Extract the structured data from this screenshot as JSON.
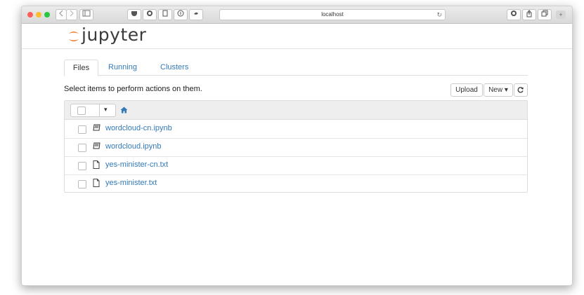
{
  "browser": {
    "address": "localhost"
  },
  "app": {
    "logo_text": "jupyter"
  },
  "tabs": [
    {
      "label": "Files",
      "active": true
    },
    {
      "label": "Running",
      "active": false
    },
    {
      "label": "Clusters",
      "active": false
    }
  ],
  "toolbar": {
    "instructions": "Select items to perform actions on them.",
    "upload_label": "Upload",
    "new_label": "New",
    "new_caret": "▾",
    "refresh_icon": "refresh-icon"
  },
  "list_header": {
    "dropdown_caret": "▾",
    "home_icon": "home-icon"
  },
  "files": [
    {
      "name": "wordcloud-cn.ipynb",
      "icon": "notebook-icon"
    },
    {
      "name": "wordcloud.ipynb",
      "icon": "notebook-icon"
    },
    {
      "name": "yes-minister-cn.txt",
      "icon": "file-icon"
    },
    {
      "name": "yes-minister.txt",
      "icon": "file-icon"
    }
  ],
  "colors": {
    "accent": "#337ab7",
    "logo_orange": "#f37726"
  }
}
